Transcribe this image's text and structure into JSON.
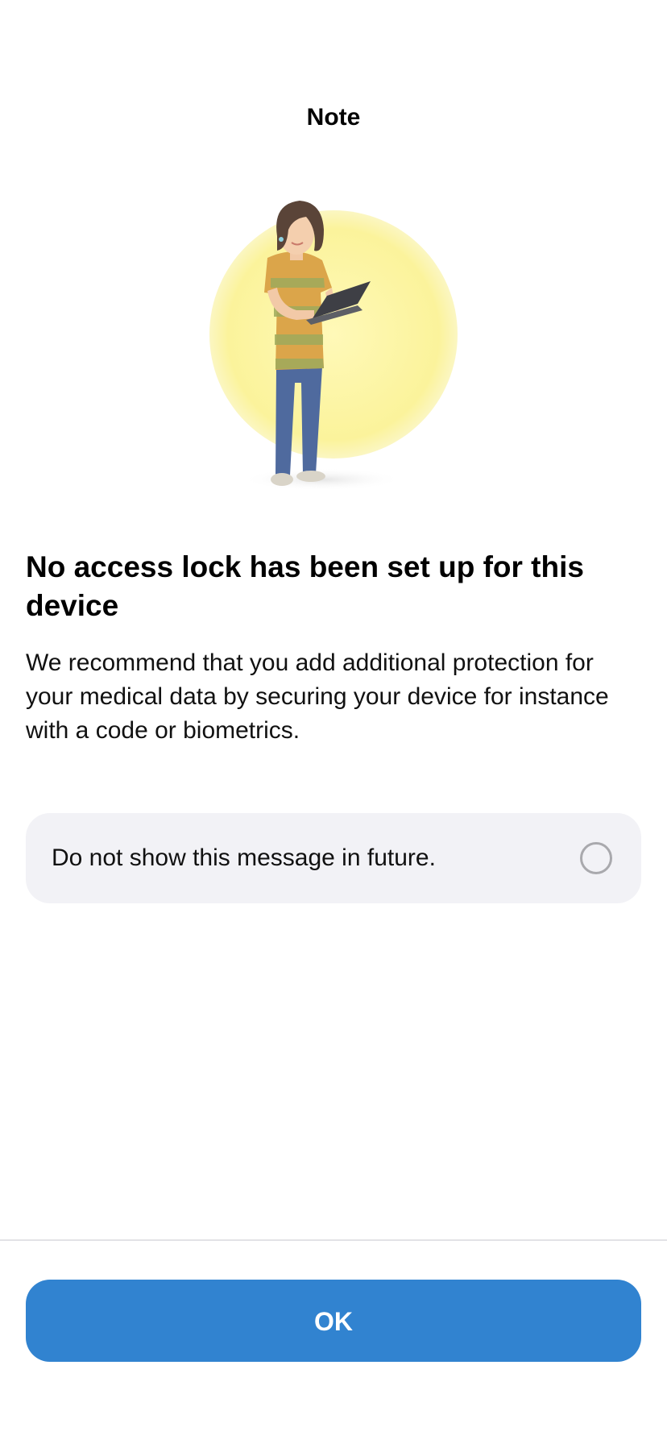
{
  "header": {
    "title": "Note"
  },
  "illustration": {
    "icon": "woman-with-laptop-illustration",
    "circle_color": "#fbf39b"
  },
  "content": {
    "headline": "No access lock has been set up for this device",
    "body": "We recommend that you add additional protection for your medical data by securing your device for instance with a code or biometrics."
  },
  "option": {
    "label": "Do not show this message in future.",
    "checked": false,
    "icon": "radio-unchecked-icon"
  },
  "footer": {
    "ok_label": "OK",
    "accent_color": "#3183d0"
  }
}
